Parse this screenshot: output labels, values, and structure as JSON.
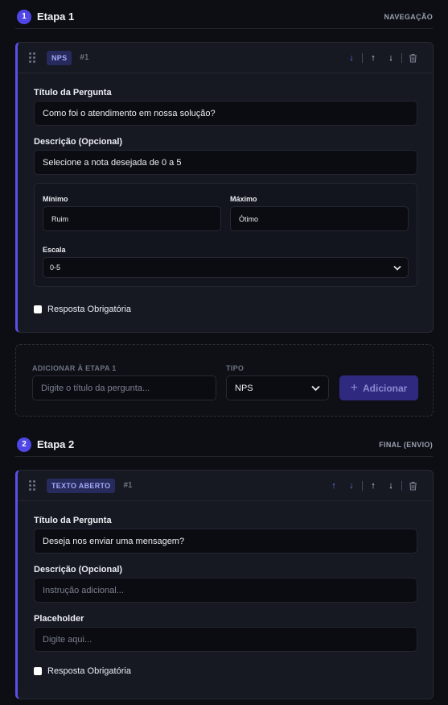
{
  "stages": [
    {
      "number": "1",
      "title": "Etapa 1",
      "tag": "NAVEGAÇÃO"
    },
    {
      "number": "2",
      "title": "Etapa 2",
      "tag": "FINAL (ENVIO)"
    }
  ],
  "question1": {
    "type_badge": "NPS",
    "number": "#1",
    "title_label": "Título da Pergunta",
    "title_value": "Como foi o atendimento em nossa solução?",
    "description_label": "Descrição (Opcional)",
    "description_value": "Selecione a nota desejada de 0 a 5",
    "min_label": "Mínimo",
    "min_value": "Ruim",
    "max_label": "Máximo",
    "max_value": "Ótimo",
    "scale_label": "Escala",
    "scale_value": "0-5",
    "required_label": "Resposta Obrigatória"
  },
  "add_block": {
    "question_label": "ADICIONAR À ETAPA 1",
    "question_placeholder": "Digite o título da pergunta...",
    "type_label": "TIPO",
    "type_value": "NPS",
    "add_button": "Adicionar"
  },
  "question2": {
    "type_badge": "TEXTO ABERTO",
    "number": "#1",
    "title_label": "Título da Pergunta",
    "title_value": "Deseja nos enviar uma mensagem?",
    "description_label": "Descrição (Opcional)",
    "description_placeholder": "Instrução adicional...",
    "placeholder_label": "Placeholder",
    "placeholder_placeholder": "Digite aqui...",
    "required_label": "Resposta Obrigatória"
  },
  "icons": {
    "drag": "drag-handle-icon",
    "arrow_up": "↑",
    "arrow_down": "↓",
    "trash": "trash-icon",
    "chevron": "chevron-down-icon",
    "plus": "+"
  },
  "colors": {
    "accent": "#4f46e5",
    "card_bg": "#161922",
    "page_bg": "#0c0e14",
    "badge_bg": "#262a5c",
    "badge_text": "#a5a9f5",
    "move_arrow_blue": "#5a7cf0"
  }
}
